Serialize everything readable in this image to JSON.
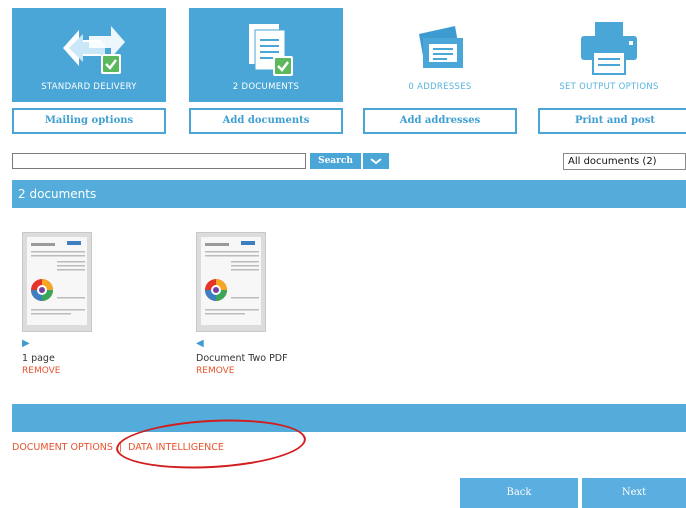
{
  "steps": [
    {
      "label": "STANDARD DELIVERY",
      "icon": "delivery-icon",
      "active": true,
      "button": "Mailing options"
    },
    {
      "label": "2 DOCUMENTS",
      "icon": "documents-icon",
      "active": true,
      "button": "Add documents"
    },
    {
      "label": "0 ADDRESSES",
      "icon": "addresses-icon",
      "active": false,
      "button": "Add addresses"
    },
    {
      "label": "SET OUTPUT OPTIONS",
      "icon": "printer-icon",
      "active": false,
      "button": "Print and post"
    }
  ],
  "search": {
    "value": "",
    "button": "Search",
    "filter": "All documents (2)"
  },
  "panel": {
    "title": "2 documents"
  },
  "documents": [
    {
      "name": "1 page",
      "remove": "REMOVE",
      "arrow": "▶"
    },
    {
      "name": "Document Two PDF",
      "remove": "REMOVE",
      "arrow": "◀"
    }
  ],
  "options": {
    "document_options": "DOCUMENT OPTIONS",
    "separator": "|",
    "data_intelligence": "DATA INTELLIGENCE"
  },
  "nav": {
    "back": "Back",
    "next": "Next"
  },
  "colors": {
    "accent": "#4aa6d6",
    "link": "#e8532c",
    "highlight": "#d31c1c",
    "check": "#5cb85c"
  }
}
